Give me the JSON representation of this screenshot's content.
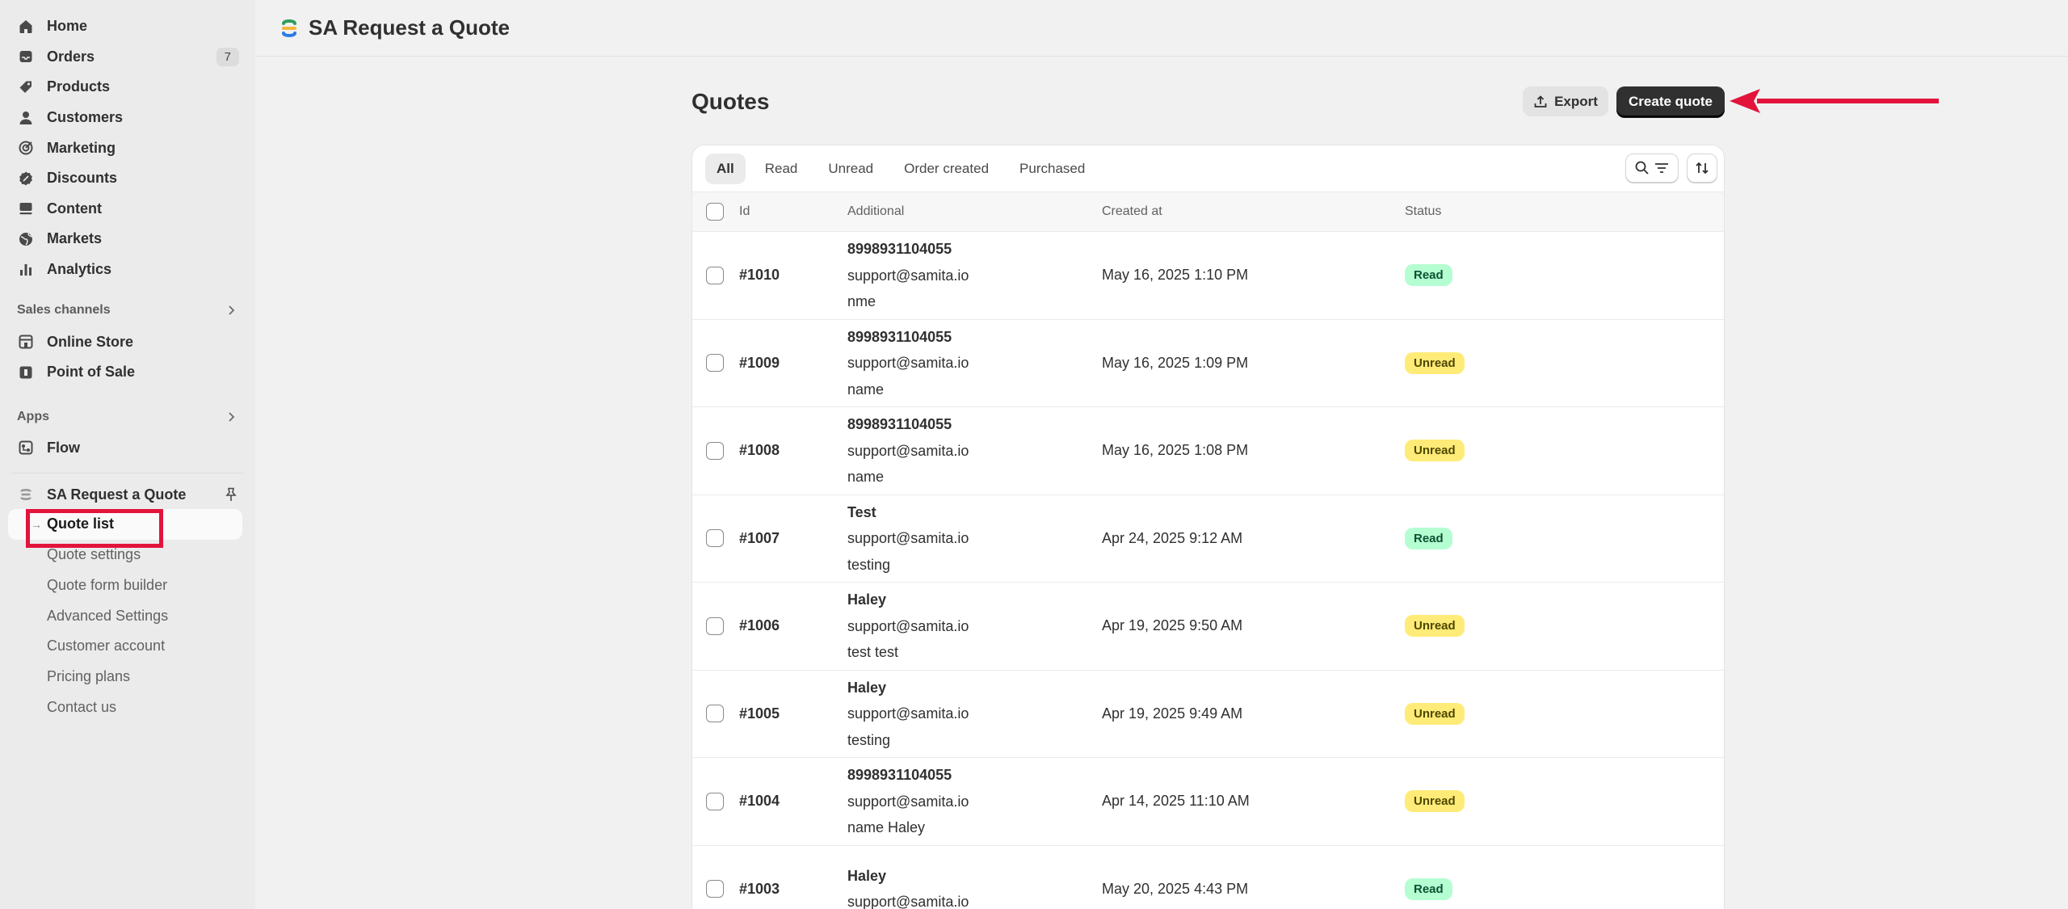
{
  "sidebar": {
    "nav": [
      {
        "label": "Home",
        "icon": "home-icon"
      },
      {
        "label": "Orders",
        "icon": "inbox-icon",
        "badge": "7"
      },
      {
        "label": "Products",
        "icon": "tag-icon"
      },
      {
        "label": "Customers",
        "icon": "person-icon"
      },
      {
        "label": "Marketing",
        "icon": "target-icon"
      },
      {
        "label": "Discounts",
        "icon": "discount-icon"
      },
      {
        "label": "Content",
        "icon": "content-icon"
      },
      {
        "label": "Markets",
        "icon": "globe-icon"
      },
      {
        "label": "Analytics",
        "icon": "bar-chart-icon"
      }
    ],
    "sales_channels": {
      "heading": "Sales channels",
      "items": [
        {
          "label": "Online Store",
          "icon": "store-icon"
        },
        {
          "label": "Point of Sale",
          "icon": "pos-icon"
        }
      ]
    },
    "apps": {
      "heading": "Apps",
      "items": [
        {
          "label": "Flow",
          "icon": "flow-icon"
        }
      ]
    },
    "app": {
      "name": "SA Request a Quote",
      "items": [
        {
          "label": "Quote list",
          "active": true
        },
        {
          "label": "Quote settings"
        },
        {
          "label": "Quote form builder"
        },
        {
          "label": "Advanced Settings"
        },
        {
          "label": "Customer account"
        },
        {
          "label": "Pricing plans"
        },
        {
          "label": "Contact us"
        }
      ],
      "active_marker": "→"
    }
  },
  "topbar": {
    "title": "SA Request a Quote"
  },
  "page": {
    "title": "Quotes",
    "export_label": "Export",
    "create_label": "Create quote"
  },
  "tabs": [
    "All",
    "Read",
    "Unread",
    "Order created",
    "Purchased"
  ],
  "active_tab": "All",
  "table": {
    "columns": [
      "Id",
      "Additional",
      "Created at",
      "Status"
    ],
    "rows": [
      {
        "id": "#1010",
        "line1": "8998931104055",
        "line2": "support@samita.io",
        "line3": "nme",
        "created": "May 16, 2025 1:10 PM",
        "status": "Read"
      },
      {
        "id": "#1009",
        "line1": "8998931104055",
        "line2": "support@samita.io",
        "line3": "name",
        "created": "May 16, 2025 1:09 PM",
        "status": "Unread"
      },
      {
        "id": "#1008",
        "line1": "8998931104055",
        "line2": "support@samita.io",
        "line3": "name",
        "created": "May 16, 2025 1:08 PM",
        "status": "Unread"
      },
      {
        "id": "#1007",
        "line1": "Test",
        "line2": "support@samita.io",
        "line3": "testing",
        "created": "Apr 24, 2025 9:12 AM",
        "status": "Read"
      },
      {
        "id": "#1006",
        "line1": "Haley",
        "line2": "support@samita.io",
        "line3": "test test",
        "created": "Apr 19, 2025 9:50 AM",
        "status": "Unread"
      },
      {
        "id": "#1005",
        "line1": "Haley",
        "line2": "support@samita.io",
        "line3": "testing",
        "created": "Apr 19, 2025 9:49 AM",
        "status": "Unread"
      },
      {
        "id": "#1004",
        "line1": "8998931104055",
        "line2": "support@samita.io",
        "line3": "name Haley",
        "created": "Apr 14, 2025 11:10 AM",
        "status": "Unread"
      },
      {
        "id": "#1003",
        "line1": "Haley",
        "line2": "support@samita.io",
        "line3": "",
        "created": "May 20, 2025 4:43 PM",
        "status": "Read"
      }
    ]
  },
  "colors": {
    "annotation_red": "#e2143c",
    "read_badge_bg": "#b4fed2",
    "unread_badge_bg": "#ffeb78",
    "primary_button_bg": "#303030"
  }
}
